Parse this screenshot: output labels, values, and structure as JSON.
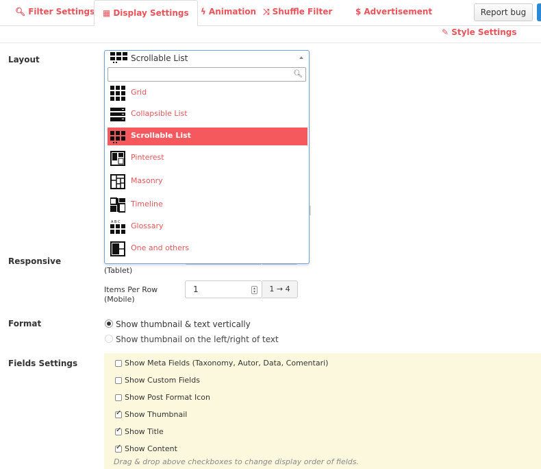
{
  "tabs": [
    {
      "label": "Filter Settings",
      "icon": "search-icon"
    },
    {
      "label": "Display Settings",
      "icon": "grid-icon"
    },
    {
      "label": "Animation",
      "icon": "bolt-icon"
    },
    {
      "label": "Shuffle Filter",
      "icon": "shuffle-icon"
    },
    {
      "label": "Advertisement",
      "icon": "dollar-icon"
    }
  ],
  "header": {
    "report_bug": "Report bug",
    "style_settings": "Style Settings"
  },
  "layout": {
    "label": "Layout",
    "selected": "Scrollable List",
    "search_placeholder": "",
    "options": [
      "Grid",
      "Collapsible List",
      "Scrollable List",
      "Pinterest",
      "Masonry",
      "Timeline",
      "Glossary",
      "One and others"
    ]
  },
  "responsive": {
    "label": "Responsive",
    "tablet_label": "(Tablet)",
    "mobile_label": "Items Per Row (Mobile)",
    "mobile_value": "1",
    "mobile_range": "1 → 4"
  },
  "format": {
    "label": "Format",
    "option_vertical": "Show thumbnail & text vertically",
    "option_side": "Show thumbnail on the left/right of text"
  },
  "fields": {
    "label": "Fields Settings",
    "items": [
      {
        "label": "Show Meta Fields (Taxonomy, Autor, Data, Comentari)",
        "checked": false
      },
      {
        "label": "Show Custom Fields",
        "checked": false
      },
      {
        "label": "Show Post Format Icon",
        "checked": false
      },
      {
        "label": "Show Thumbnail",
        "checked": true
      },
      {
        "label": "Show Title",
        "checked": true
      },
      {
        "label": "Show Content",
        "checked": true
      }
    ],
    "hint": "Drag & drop above checkboxes to change display order of fields."
  },
  "colors": {
    "accent": "#e8545a",
    "selected_bg": "#f5595e",
    "fields_bg": "#fcf8dd"
  }
}
